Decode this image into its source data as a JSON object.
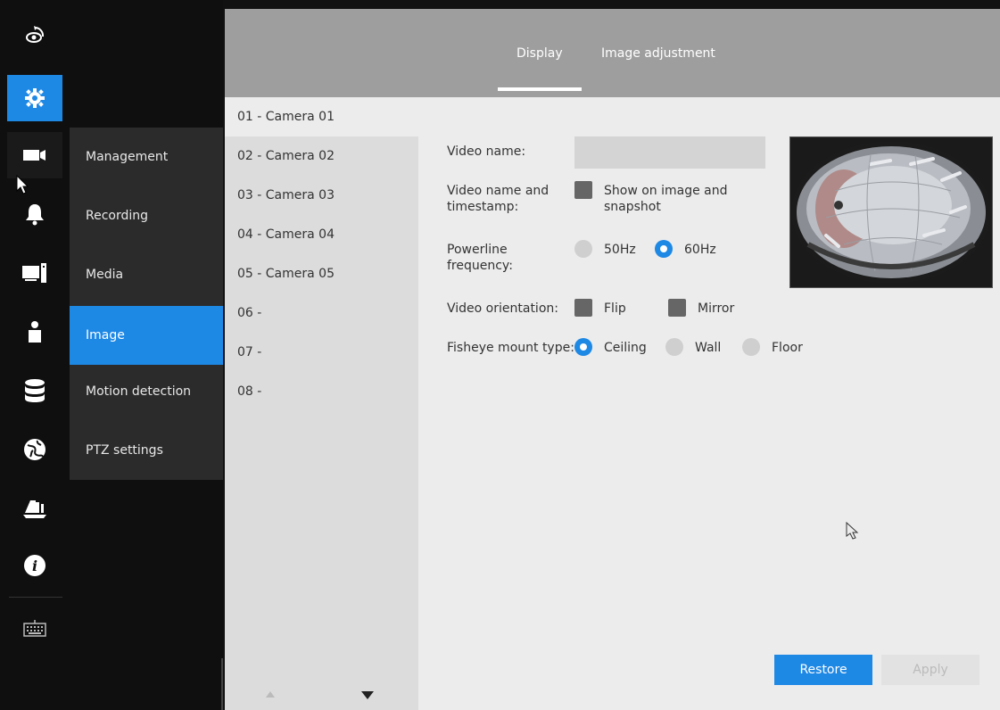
{
  "rail": {
    "icons": [
      "live-view-icon",
      "settings-gear-icon",
      "camera-icon",
      "bell-icon",
      "computer-icon",
      "person-icon",
      "database-icon",
      "globe-icon",
      "handshake-icon",
      "info-icon",
      "keyboard-icon"
    ]
  },
  "submenu": {
    "items": [
      "Management",
      "Recording",
      "Media",
      "Image",
      "Motion detection",
      "PTZ settings"
    ],
    "active": "Image"
  },
  "tabs": [
    "Display",
    "Image adjustment"
  ],
  "active_tab": "Display",
  "cameras": [
    "01 - Camera 01",
    "02 - Camera 02",
    "03 - Camera 03",
    "04 - Camera 04",
    "05 - Camera 05",
    "06 -",
    "07 -",
    "08 -"
  ],
  "form": {
    "video_name_label": "Video name:",
    "video_name_value": "",
    "name_ts_label_1": "Video name and",
    "name_ts_label_2": "timestamp:",
    "show_on_image_1": "Show on image and",
    "show_on_image_2": "snapshot",
    "powerline_label_1": "Powerline",
    "powerline_label_2": "frequency:",
    "hz50": "50Hz",
    "hz60": "60Hz",
    "powerline_selected": "60Hz",
    "orientation_label": "Video orientation:",
    "flip": "Flip",
    "mirror": "Mirror",
    "fisheye_label": "Fisheye mount type:",
    "ceiling": "Ceiling",
    "wall": "Wall",
    "floor": "Floor",
    "fisheye_selected": "Ceiling"
  },
  "buttons": {
    "restore": "Restore",
    "apply": "Apply"
  },
  "colors": {
    "accent": "#1e88e5",
    "rail_bg": "#0f0f0f",
    "header_bg": "#9e9e9e"
  }
}
